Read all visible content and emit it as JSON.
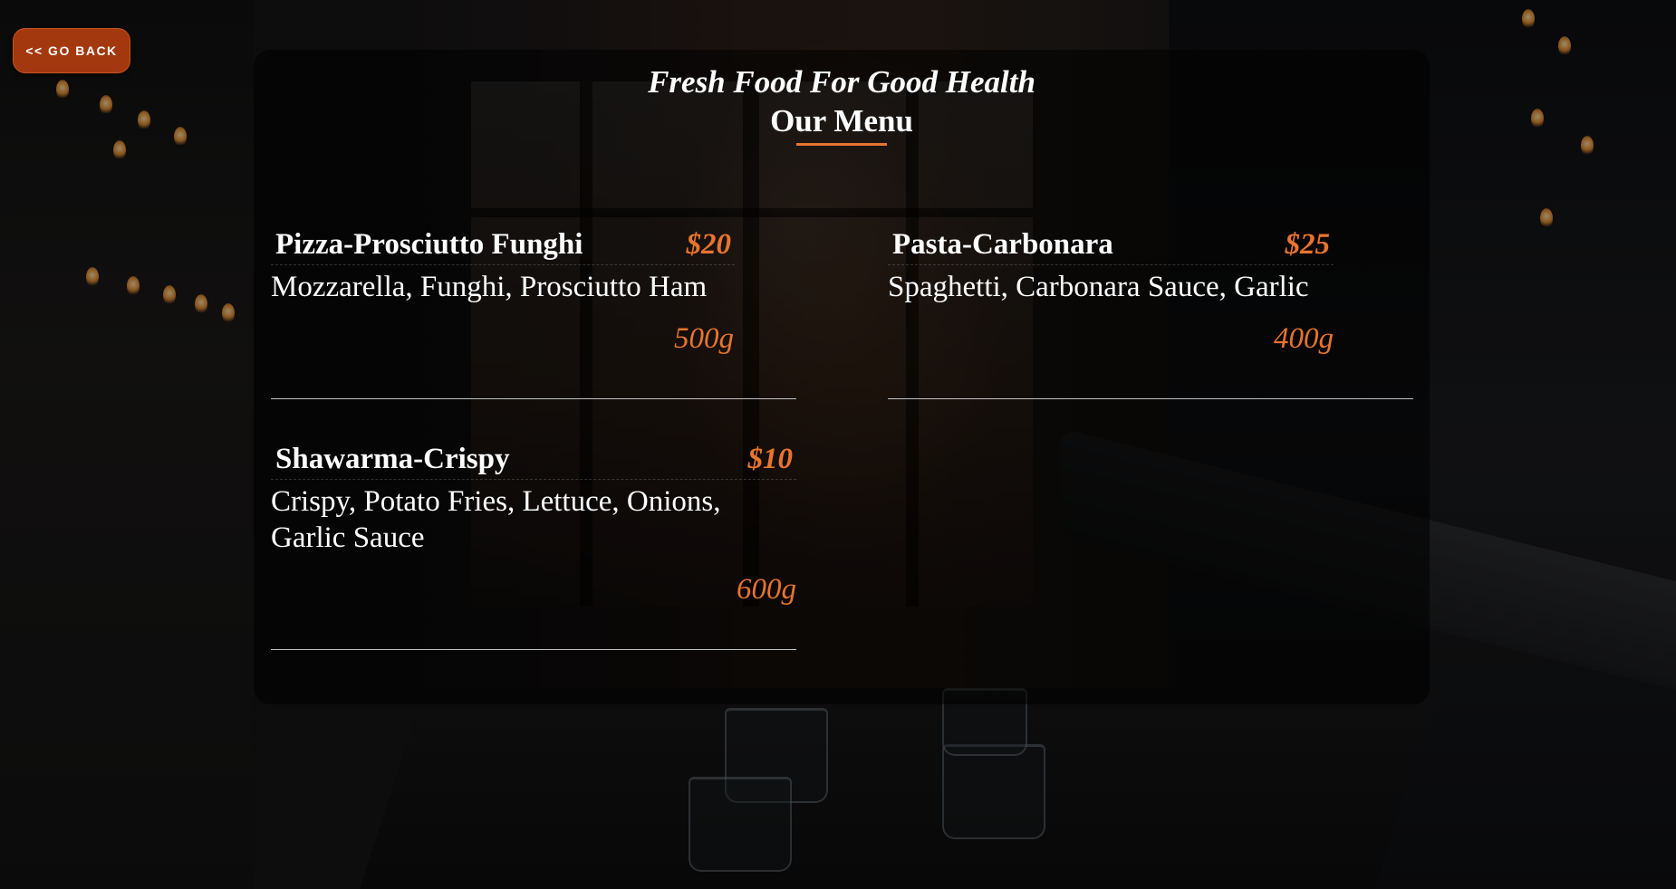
{
  "nav": {
    "back_label": "<< GO BACK"
  },
  "menu": {
    "subtitle": "Fresh Food For Good Health",
    "title": "Our Menu",
    "items": [
      {
        "name": "Pizza-Prosciutto Funghi",
        "price": "$20",
        "description": "Mozzarella, Funghi, Prosciutto Ham",
        "weight": "500g"
      },
      {
        "name": "Pasta-Carbonara",
        "price": "$25",
        "description": "Spaghetti, Carbonara Sauce, Garlic",
        "weight": "400g"
      },
      {
        "name": "Shawarma-Crispy",
        "price": "$10",
        "description": "Crispy, Potato Fries, Lettuce, Onions, Garlic Sauce",
        "weight": "600g"
      }
    ]
  },
  "colors": {
    "accent": "#e8742e",
    "button": "#a3380f",
    "text": "#ffffff"
  }
}
